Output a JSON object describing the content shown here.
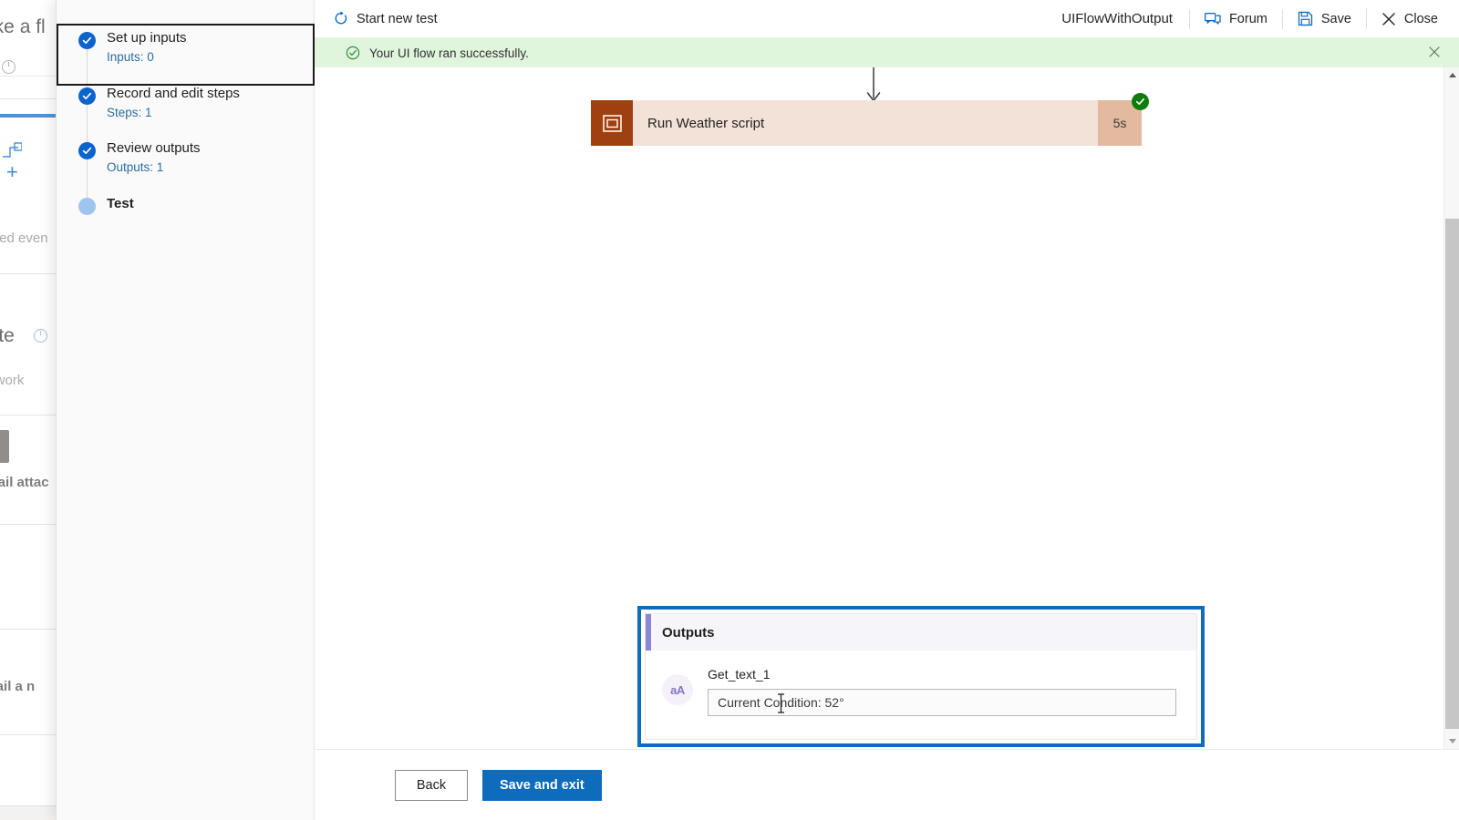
{
  "background_page": {
    "title_fragment": "ake a fl",
    "fragments": [
      {
        "text": "gnated even",
        "style": "normal"
      },
      {
        "text": "late",
        "style": "normal"
      },
      {
        "text": "te work",
        "style": "normal"
      },
      {
        "text": "email attac",
        "style": "bold"
      },
      {
        "text": "email a n",
        "style": "bold"
      }
    ],
    "icons": [
      "info-icon",
      "flow-icon",
      "plus-icon",
      "info-icon-blue"
    ]
  },
  "wizard": {
    "steps": [
      {
        "title": "Set up inputs",
        "sub": "Inputs: 0",
        "state": "complete",
        "focused": true
      },
      {
        "title": "Record and edit steps",
        "sub": "Steps: 1",
        "state": "complete",
        "focused": false
      },
      {
        "title": "Review outputs",
        "sub": "Outputs: 1",
        "state": "complete",
        "focused": false
      },
      {
        "title": "Test",
        "sub": "",
        "state": "current",
        "focused": false
      }
    ]
  },
  "commandbar": {
    "start_new_test": "Start new test",
    "flow_name": "UIFlowWithOutput",
    "forum": "Forum",
    "save": "Save",
    "close": "Close",
    "icons": {
      "restart": "restart-icon",
      "forum": "forum-icon",
      "save": "save-disk-icon",
      "close": "close-x-icon"
    }
  },
  "banner": {
    "message": "Your UI flow ran successfully.",
    "icon": "check-circle-icon",
    "close_icon": "close-x-icon",
    "background": "#dff6dd"
  },
  "canvas": {
    "run_card": {
      "label": "Run Weather script",
      "duration": "5s",
      "status": "succeeded",
      "icon": "script-window-icon",
      "icon_color": "#a1400f",
      "body_color": "#f3e2d8",
      "time_color": "#e3b99f",
      "status_color": "#107c10"
    },
    "connector": "arrow-down"
  },
  "outputs_panel": {
    "title": "Outputs",
    "accent_color": "#8a88d4",
    "focus_color": "#0f6cbd",
    "rows": [
      {
        "avatar_icon": "aA",
        "label": "Get_text_1",
        "value": "Current Condition: 52°"
      }
    ]
  },
  "footer": {
    "back": "Back",
    "save_and_exit": "Save and exit",
    "primary_color": "#0f6cbd"
  },
  "scrollbar": {
    "up_arrow": "scroll-up-icon",
    "down_arrow": "scroll-down-icon",
    "orientation": "vertical"
  }
}
